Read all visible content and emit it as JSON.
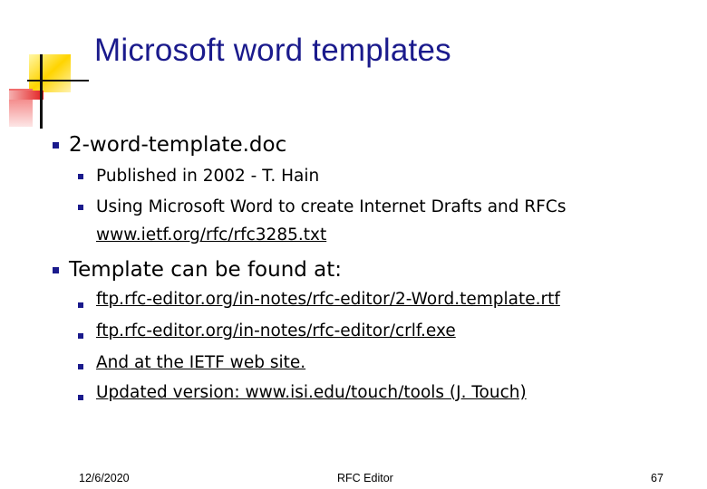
{
  "slide": {
    "title": "Microsoft word templates",
    "bullets": [
      {
        "text": "2-word-template.doc",
        "sub": [
          "Published in 2002 - T. Hain",
          "Using Microsoft Word to create Internet Drafts and RFCs"
        ],
        "link": " www.ietf.org/rfc/rfc3285.txt"
      },
      {
        "text": "Template can be found at:",
        "sub": [
          "ftp.rfc-editor.org/in-notes/rfc-editor/2-Word.template.rtf",
          "ftp.rfc-editor.org/in-notes/rfc-editor/crlf.exe",
          "And at the IETF web site.",
          "Updated version: www.isi.edu/touch/tools (J. Touch)"
        ]
      }
    ]
  },
  "footer": {
    "date": "12/6/2020",
    "center": "RFC Editor",
    "page": "67"
  },
  "colors": {
    "title": "#1a1a8c",
    "bullet": "#1a1a8c",
    "accent_yellow": "#ffd700",
    "accent_red": "#e81e1e"
  }
}
